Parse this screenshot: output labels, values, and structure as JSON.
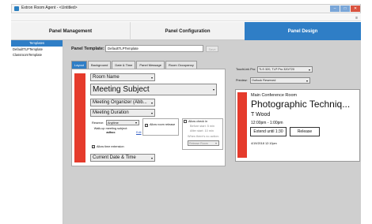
{
  "window": {
    "title": "Extron Room Agent - <Untitled>",
    "min": "–",
    "max": "□",
    "close": "✕"
  },
  "menu": {
    "icon": "≡"
  },
  "nav": {
    "tabs": [
      "Panel Management",
      "Panel Configuration",
      "Panel Design"
    ],
    "active": 2
  },
  "sidebar": {
    "header": "Templates",
    "items": [
      "DefaultTLPTemplate",
      "ClassroomTemplate"
    ]
  },
  "template": {
    "label": "Panel Template:",
    "value": "DefaultTLPTemplate",
    "save_label": "Save"
  },
  "subtabs": {
    "items": [
      "Layout",
      "Background",
      "Date & Time",
      "Panel Message",
      "Room Occupancy"
    ],
    "active": 0
  },
  "editor": {
    "room_name": "Room Name",
    "subject": "Meeting Subject",
    "organizer": "Meeting Organizer (Abb...",
    "duration": "Meeting Duration",
    "date_time": "Current Date & Time",
    "reserve_label": "Reserve:",
    "reserve_value": "Anytime",
    "walkup_label": "Walk-up meeting subject:",
    "walkup_value": "adhoc",
    "edit_link": "Edit",
    "allow_time_ext": "Allow time extension",
    "allow_release": "Allow room release",
    "allow_checkin": "Allow check in",
    "before_start": "Before start: 5 min",
    "after_start": "After start: 10 min",
    "no_action": "When there's no action:",
    "no_action_value": "Release Room",
    "check": "✓",
    "arrow": "▾"
  },
  "options": {
    "touchlink_label": "TouchLink Pro:",
    "touchlink_value": "TLS 320, TLP Pro 320/720",
    "preview_label": "Preview:",
    "preview_value": "Outlook Reserved"
  },
  "preview": {
    "room": "Main Conference Room",
    "subject": "Photographic Techniq...",
    "organizer": "T Wood",
    "time": "12:00pm - 1:00pm",
    "extend": "Extend until 1:30",
    "release": "Release",
    "date": "4/19/2018  12:10pm"
  },
  "colors": {
    "accent": "#2f7ec6",
    "status_red": "#e53b2c"
  }
}
